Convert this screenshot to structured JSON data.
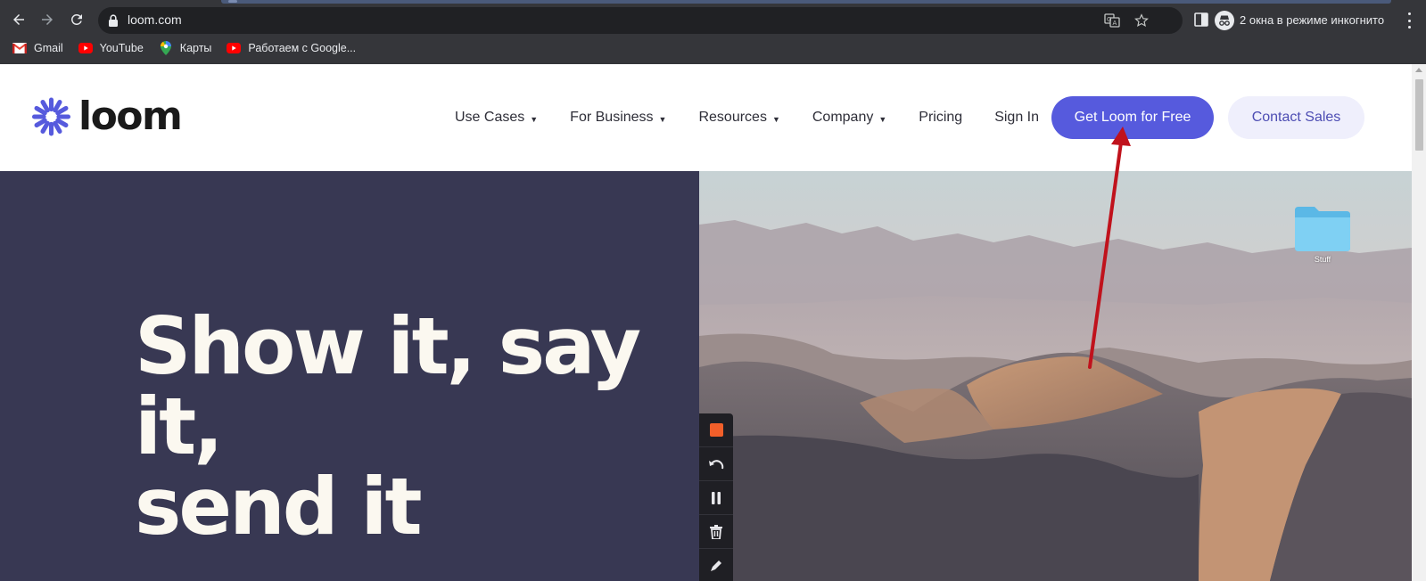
{
  "browser": {
    "url": "loom.com",
    "incognito_label": "2 окна в режиме инкогнито",
    "bookmarks": [
      {
        "label": "Gmail",
        "icon": "gmail-icon"
      },
      {
        "label": "YouTube",
        "icon": "youtube-icon"
      },
      {
        "label": "Карты",
        "icon": "maps-pin-icon"
      },
      {
        "label": "Работаем с Google...",
        "icon": "youtube-icon"
      }
    ],
    "accent_colors": {
      "chrome": "#35363a",
      "omnibox": "#202124"
    }
  },
  "site": {
    "logo_text": "loom",
    "nav": [
      {
        "label": "Use Cases",
        "has_caret": true
      },
      {
        "label": "For Business",
        "has_caret": true
      },
      {
        "label": "Resources",
        "has_caret": true
      },
      {
        "label": "Company",
        "has_caret": true
      },
      {
        "label": "Pricing",
        "has_caret": false
      },
      {
        "label": "Sign In",
        "has_caret": false
      }
    ],
    "cta_primary": "Get Loom for Free",
    "cta_secondary": "Contact Sales",
    "caret_glyph": "▼",
    "colors": {
      "brand": "#565ADD",
      "hero_bg": "#383853",
      "hero_text": "#fbf8f0",
      "cta_secondary_bg": "#efeffc"
    }
  },
  "hero": {
    "title_line1": "Show it, say it,",
    "title_line2": "send it",
    "folder_label": "Stuff"
  },
  "recorder": {
    "icons": [
      "stop-icon",
      "undo-icon",
      "pause-icon",
      "trash-icon",
      "pen-icon"
    ]
  },
  "annotation": {
    "color": "#c0121c",
    "target": "Get Loom for Free"
  }
}
